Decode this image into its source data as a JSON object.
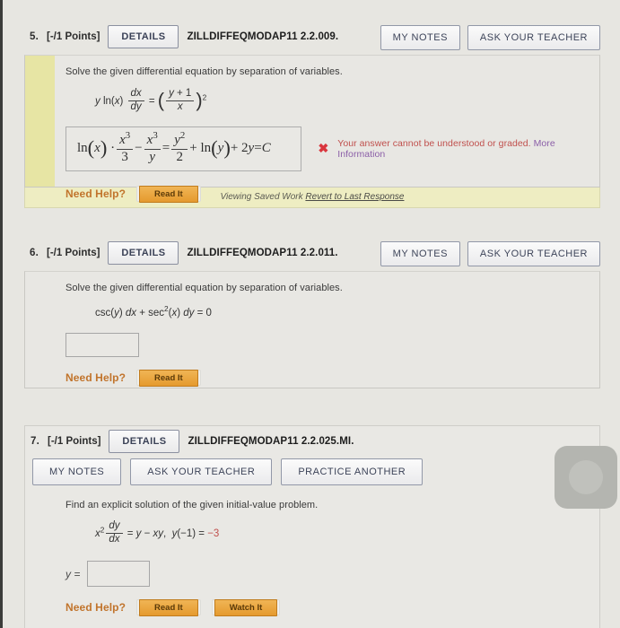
{
  "problems": [
    {
      "number": "5.",
      "points": "[-/1 Points]",
      "details_label": "DETAILS",
      "code": "ZILLDIFFEQMODAP11 2.2.009.",
      "my_notes_label": "MY NOTES",
      "ask_teacher_label": "ASK YOUR TEACHER",
      "prompt": "Solve the given differential equation by separation of variables.",
      "equation_text": "y ln(x) dx/dy = ((y + 1)/x)^2",
      "answer_text": "ln(x) · x³/3 − x³/y = y²/2 + ln(y) + 2y = C",
      "mark": "✖",
      "feedback": "Your answer cannot be understood or graded.",
      "feedback_link": "More Information",
      "need_help_label": "Need Help?",
      "read_it_label": "Read It",
      "saved_work_text": "Viewing Saved Work",
      "revert_link": "Revert to Last Response"
    },
    {
      "number": "6.",
      "points": "[-/1 Points]",
      "details_label": "DETAILS",
      "code": "ZILLDIFFEQMODAP11 2.2.011.",
      "my_notes_label": "MY NOTES",
      "ask_teacher_label": "ASK YOUR TEACHER",
      "prompt": "Solve the given differential equation by separation of variables.",
      "equation_text": "csc(y) dx + sec²(x) dy = 0",
      "answer_value": "",
      "need_help_label": "Need Help?",
      "read_it_label": "Read It"
    },
    {
      "number": "7.",
      "points": "[-/1 Points]",
      "details_label": "DETAILS",
      "code": "ZILLDIFFEQMODAP11 2.2.025.MI.",
      "my_notes_label": "MY NOTES",
      "ask_teacher_label": "ASK YOUR TEACHER",
      "practice_another_label": "PRACTICE ANOTHER",
      "prompt": "Find an explicit solution of the given initial-value problem.",
      "equation_text": "x² dy/dx = y − xy,  y(−1) = −3",
      "initial_value": "−3",
      "y_label": "y =",
      "answer_value": "",
      "need_help_label": "Need Help?",
      "read_it_label": "Read It",
      "watch_it_label": "Watch It"
    }
  ],
  "colors": {
    "page_background": "#e7e6e1",
    "yellow_strip": "#e7e5a4",
    "help_button": "#e59a2e",
    "error_red": "#c0504d",
    "link_purple": "#8b5fa8",
    "need_help_orange": "#c1742c"
  },
  "float_widget": {
    "name": "accessibility-widget"
  }
}
